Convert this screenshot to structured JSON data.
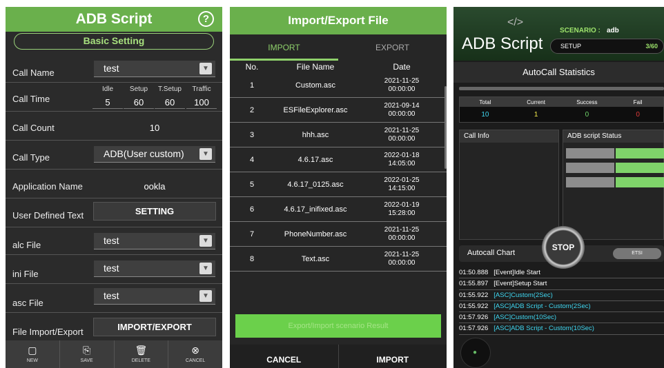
{
  "screen1": {
    "title": "ADB Script",
    "help_icon": "?",
    "section": "Basic Setting",
    "call_name": {
      "label": "Call Name",
      "value": "test"
    },
    "call_time": {
      "label": "Call Time",
      "cols": [
        {
          "h": "Idle",
          "v": "5"
        },
        {
          "h": "Setup",
          "v": "60"
        },
        {
          "h": "T.Setup",
          "v": "60"
        },
        {
          "h": "Traffic",
          "v": "100"
        }
      ]
    },
    "call_count": {
      "label": "Call Count",
      "value": "10"
    },
    "call_type": {
      "label": "Call Type",
      "value": "ADB(User custom)"
    },
    "app_name": {
      "label": "Application Name",
      "value": "ookla"
    },
    "user_text": {
      "label": "User Defined Text",
      "button": "SETTING"
    },
    "alc_file": {
      "label": "alc File",
      "value": "test"
    },
    "ini_file": {
      "label": "ini File",
      "value": "test"
    },
    "asc_file": {
      "label": "asc File",
      "value": "test"
    },
    "import_export": {
      "label": "File Import/Export",
      "button": "IMPORT/EXPORT"
    },
    "toolbar": {
      "new": {
        "label": "NEW",
        "icon": "new-file-icon"
      },
      "save": {
        "label": "SAVE",
        "icon": "save-icon"
      },
      "delete": {
        "label": "DELETE",
        "icon": "trash-icon"
      },
      "cancel": {
        "label": "CANCEL",
        "icon": "cancel-icon"
      }
    }
  },
  "screen2": {
    "title": "Import/Export File",
    "tabs": {
      "import": "IMPORT",
      "export": "EXPORT"
    },
    "columns": {
      "no": "No.",
      "name": "File Name",
      "date": "Date"
    },
    "files": [
      {
        "no": "1",
        "name": "Custom.asc",
        "date": "2021-11-25",
        "time": "00:00:00"
      },
      {
        "no": "2",
        "name": "ESFileExplorer.asc",
        "date": "2021-09-14",
        "time": "00:00:00"
      },
      {
        "no": "3",
        "name": "hhh.asc",
        "date": "2021-11-25",
        "time": "00:00:00"
      },
      {
        "no": "4",
        "name": "4.6.17.asc",
        "date": "2022-01-18",
        "time": "14:05:00"
      },
      {
        "no": "5",
        "name": "4.6.17_0125.asc",
        "date": "2022-01-25",
        "time": "14:15:00"
      },
      {
        "no": "6",
        "name": "4.6.17_inifixed.asc",
        "date": "2022-01-19",
        "time": "15:28:00"
      },
      {
        "no": "7",
        "name": "PhoneNumber.asc",
        "date": "2021-11-25",
        "time": "00:00:00"
      },
      {
        "no": "8",
        "name": "Text.asc",
        "date": "2021-11-25",
        "time": "00:00:00"
      }
    ],
    "result_text": "Export/Import scenario Result",
    "cancel": "CANCEL",
    "import": "IMPORT"
  },
  "screen3": {
    "code_icon": "</>",
    "brand": "ADB Script",
    "scenario_label": "SCENARIO :",
    "scenario_value": "adb",
    "setup_label": "SETUP",
    "setup_progress": "3/60",
    "stats_title": "AutoCall Statistics",
    "stats": {
      "headers": [
        "Total",
        "Current",
        "Success",
        "Fail"
      ],
      "values": [
        "10",
        "1",
        "0",
        "0"
      ],
      "colors": [
        "#3fd6f0",
        "#f2e94b",
        "#6fd36a",
        "#e03b3b"
      ]
    },
    "call_info": "Call Info",
    "adb_status": "ADB script Status",
    "chart_label": "Autocall Chart",
    "stop": "STOP",
    "etsi": "ETSI",
    "log": [
      {
        "t": "01:50.888",
        "m": "[Event]Idle Start",
        "c": "w"
      },
      {
        "t": "01:55.897",
        "m": "[Event]Setup Start",
        "c": "w"
      },
      {
        "t": "01:55.922",
        "m": "[ASC]Custom(2Sec)",
        "c": "cy"
      },
      {
        "t": "01:55.922",
        "m": "[ASC]ADB Script - Custom(2Sec)",
        "c": "cy"
      },
      {
        "t": "01:57.926",
        "m": "[ASC]Custom(10Sec)",
        "c": "cy"
      },
      {
        "t": "01:57.926",
        "m": "[ASC]ADB Script - Custom(10Sec)",
        "c": "cy"
      }
    ],
    "accent": "#6ab04c"
  }
}
